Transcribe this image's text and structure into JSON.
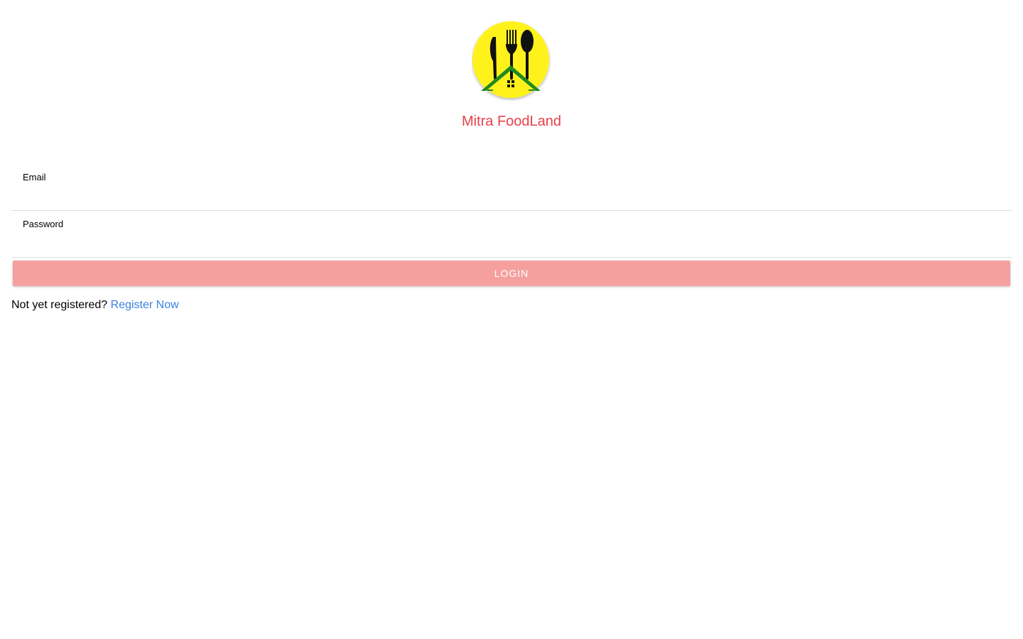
{
  "app": {
    "title": "Mitra FoodLand",
    "title_color": "#e94149",
    "logo_icon": "restaurant-home-logo",
    "logo_bg_color": "#fff21a"
  },
  "form": {
    "email_label": "Email",
    "email_value": "",
    "password_label": "Password",
    "password_value": "",
    "login_label": "Login",
    "login_color": "#f5a09f"
  },
  "footer": {
    "prompt": "Not yet registered?",
    "register_link": "Register Now",
    "link_color": "#3b82e0"
  }
}
